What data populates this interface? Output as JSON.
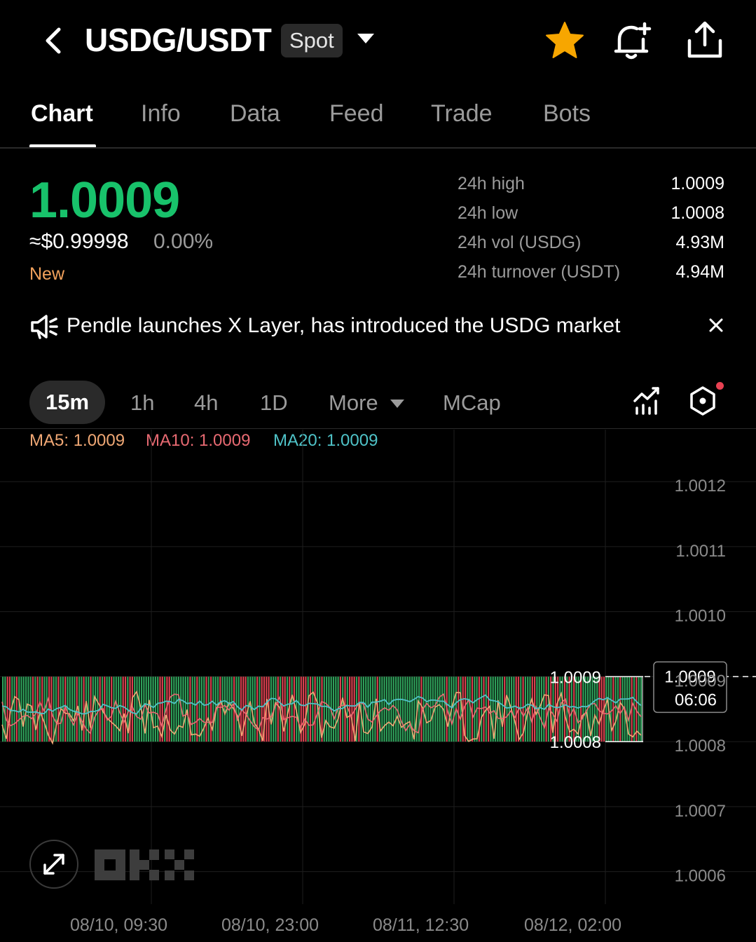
{
  "header": {
    "pair": "USDG/USDT",
    "market_type": "Spot"
  },
  "tabs": [
    "Chart",
    "Info",
    "Data",
    "Feed",
    "Trade",
    "Bots"
  ],
  "active_tab": "Chart",
  "price": {
    "last": "1.0009",
    "usd_equiv": "≈$0.99998",
    "change_pct": "0.00%",
    "tag": "New",
    "color_up": "#18c26b"
  },
  "stats": [
    {
      "label": "24h high",
      "value": "1.0009"
    },
    {
      "label": "24h low",
      "value": "1.0008"
    },
    {
      "label": "24h vol (USDG)",
      "value": "4.93M"
    },
    {
      "label": "24h turnover (USDT)",
      "value": "4.94M"
    }
  ],
  "announcement": {
    "text": "Pendle launches X Layer, has introduced the USDG market"
  },
  "timeframes": {
    "items": [
      "15m",
      "1h",
      "4h",
      "1D"
    ],
    "active": "15m",
    "more": "More",
    "mcap": "MCap"
  },
  "ma_legend": [
    {
      "label": "MA5: ",
      "value": "1.0009",
      "color": "#f0a875"
    },
    {
      "label": "MA10: ",
      "value": "1.0009",
      "color": "#e86a72"
    },
    {
      "label": "MA20: ",
      "value": "1.0009",
      "color": "#4fc3c8"
    }
  ],
  "chart_data": {
    "type": "candlestick",
    "interval": "15m",
    "y_ticks": [
      "1.0012",
      "1.0011",
      "1.0010",
      "1.0009",
      "1.0008",
      "1.0007",
      "1.0006"
    ],
    "ylim": [
      1.00055,
      1.00128
    ],
    "x_ticks": [
      "08/10, 09:30",
      "08/10, 23:00",
      "08/11, 12:30",
      "08/12, 02:00"
    ],
    "range_high": "1.0009",
    "range_low": "1.0008",
    "current_price": "1.0009",
    "countdown": "06:06",
    "candle_high": 1.0009,
    "candle_low": 1.0008,
    "up_color": "#2fa05a",
    "down_color": "#d9414f",
    "ma5_color": "#f0a875",
    "ma10_color": "#e86a72",
    "ma20_color": "#4fc3c8"
  }
}
